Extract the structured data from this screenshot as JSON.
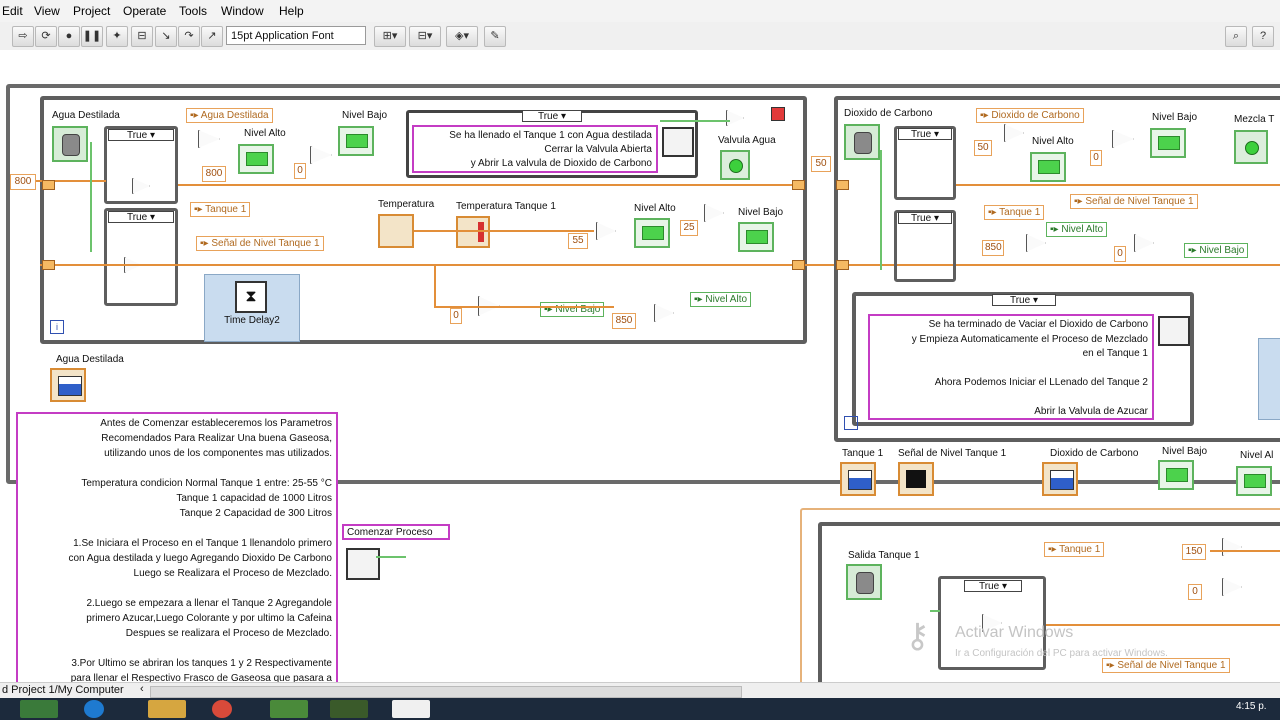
{
  "menu": [
    "Edit",
    "View",
    "Project",
    "Operate",
    "Tools",
    "Window",
    "Help"
  ],
  "toolbar": {
    "font_label": "15pt Application Font"
  },
  "icons": [
    "run-arrow-icon",
    "run-continuous-icon",
    "abort-icon",
    "pause-icon",
    "highlight-icon",
    "retain-wire-icon",
    "step-into-icon",
    "step-over-icon",
    "step-out-icon",
    "align-icon",
    "distribute-icon",
    "reorder-icon",
    "clean-up-icon",
    "search-icon",
    "help-icon"
  ],
  "colors": {
    "wire_numeric": "#e38f3a",
    "wire_boolean": "#6cc36c",
    "frame": "#5e5e5e",
    "message": "#c43cc4"
  },
  "left_loop": {
    "agua_destilada": "Agua Destilada",
    "case_true": "True",
    "local_agua": "Agua Destilada",
    "nivel_alto": "Nivel Alto",
    "nivel_bajo": "Nivel Bajo",
    "n800": "800",
    "n0": "0",
    "msg_case_true": "True",
    "msg": "Se ha llenado el Tanque 1 con Agua destilada\nCerrar la Valvula Abierta\ny Abrir La valvula de Dioxido de Carbono",
    "valvula_agua": "Valvula Agua",
    "n800_input": "800",
    "tanque1": "Tanque 1",
    "senal": "Señal de Nivel Tanque 1",
    "temperatura": "Temperatura",
    "temperatura_t1": "Temperatura Tanque 1",
    "nivel_alto2": "Nivel Alto",
    "nivel_bajo2": "Nivel Bajo",
    "n55": "55",
    "n25": "25",
    "time_delay": "Time Delay2",
    "n0b": "0",
    "nivel_bajo_local": "Nivel Bajo",
    "n850": "850",
    "nivel_alto_local": "Nivel Alto",
    "info": "i"
  },
  "right_loop": {
    "dioxido": "Dioxido de Carbono",
    "local_dioxido": "Dioxido de Carbono",
    "case_true": "True",
    "n50": "50",
    "n50_input": "50",
    "nivel_alto": "Nivel Alto",
    "nivel_bajo": "Nivel Bajo",
    "mezcla": "Mezcla T",
    "n0": "0",
    "senal": "Señal de Nivel Tanque 1",
    "tanque1": "Tanque 1",
    "n850": "850",
    "nivel_alto_local": "Nivel Alto",
    "nivel_bajo_local": "Nivel Bajo",
    "n0b": "0",
    "case2_true": "True",
    "msg_case_true": "True",
    "msg": "Se ha terminado de  Vaciar el  Dioxido de Carbono\ny Empieza Automaticamente el Proceso de Mezclado\nen el Tanque 1\n\nAhora Podemos Iniciar el LLenado del Tanque 2\n\nAbrir la Valvula de Azucar"
  },
  "indicators_row": {
    "tanque1": "Tanque 1",
    "senal": "Señal de Nivel Tanque 1",
    "dioxido": "Dioxido de Carbono",
    "nivel_bajo": "Nivel Bajo",
    "nivel_al": "Nivel Al"
  },
  "bottom_right": {
    "salida": "Salida Tanque 1",
    "case_true": "True",
    "tanque1": "Tanque 1",
    "n150": "150",
    "n0": "0",
    "senal": "Señal de Nivel Tanque 1",
    "watermark1": "Activar Windows",
    "watermark2": "Ir a Configuración del PC para activar Windows."
  },
  "agua_destilada_indicator": "Agua Destilada",
  "comment": "Antes de Comenzar estableceremos los Parametros\nRecomendados Para Realizar Una buena Gaseosa,\nutilizando unos de los componentes mas utilizados.\n\nTemperatura condicion Normal Tanque 1 entre: 25-55 °C\nTanque 1 capacidad de 1000 Litros\nTanque 2 Capacidad de 300 Litros\n\n1.Se Iniciara el Proceso en el Tanque 1 llenandolo primero\ncon Agua destilada y luego Agregando Dioxido De Carbono\nLuego se Realizara el Proceso de Mezclado.\n\n2.Luego se empezara a llenar el Tanque 2 Agregandole\nprimero Azucar,Luego Colorante y por ultimo la Cafeina\nDespues se realizara el Proceso de Mezclado.\n\n3.Por Ultimo se abriran los tanques 1 y 2 Respectivamente\npara llenar el Respectivo Frasco de Gaseosa que pasara a",
  "comenzar": "Comenzar Proceso",
  "status": {
    "path": "d Project 1/My Computer",
    "clock": "4:15 p."
  }
}
